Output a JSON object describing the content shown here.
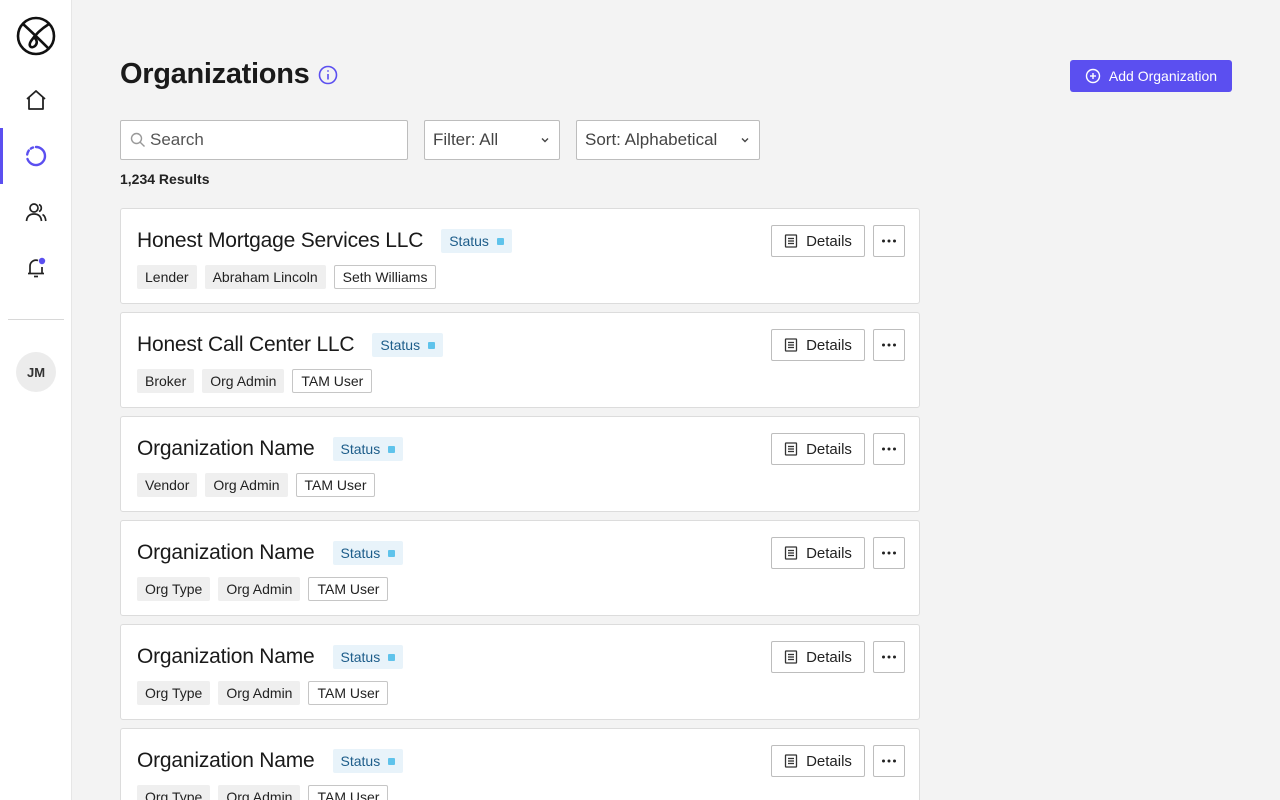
{
  "sidebar": {
    "items": [
      {
        "name": "home",
        "icon": "home-icon"
      },
      {
        "name": "organizations",
        "icon": "loading-circle-icon",
        "active": true
      },
      {
        "name": "users",
        "icon": "users-icon"
      },
      {
        "name": "notifications",
        "icon": "bell-icon"
      }
    ],
    "avatar_initials": "JM"
  },
  "header": {
    "title": "Organizations",
    "add_button_label": "Add Organization"
  },
  "filters": {
    "search_placeholder": "Search",
    "filter_label": "Filter: All",
    "sort_label": "Sort: Alphabetical"
  },
  "results_count": "1,234 Results",
  "colors": {
    "accent": "#5b4ff0",
    "status_bg": "#e8f3fa",
    "status_dot": "#5fc3eb"
  },
  "cards": [
    {
      "name": "Honest Mortgage Services LLC",
      "status": "Status",
      "tags": [
        "Lender",
        "Abraham Lincoln",
        "Seth Williams"
      ],
      "details_label": "Details"
    },
    {
      "name": "Honest Call Center LLC",
      "status": "Status",
      "tags": [
        "Broker",
        "Org Admin",
        "TAM User"
      ],
      "details_label": "Details"
    },
    {
      "name": "Organization Name",
      "status": "Status",
      "tags": [
        "Vendor",
        "Org Admin",
        "TAM User"
      ],
      "details_label": "Details"
    },
    {
      "name": "Organization Name",
      "status": "Status",
      "tags": [
        "Org Type",
        "Org Admin",
        "TAM User"
      ],
      "details_label": "Details"
    },
    {
      "name": "Organization Name",
      "status": "Status",
      "tags": [
        "Org Type",
        "Org Admin",
        "TAM User"
      ],
      "details_label": "Details"
    },
    {
      "name": "Organization Name",
      "status": "Status",
      "tags": [
        "Org Type",
        "Org Admin",
        "TAM User"
      ],
      "details_label": "Details"
    }
  ]
}
